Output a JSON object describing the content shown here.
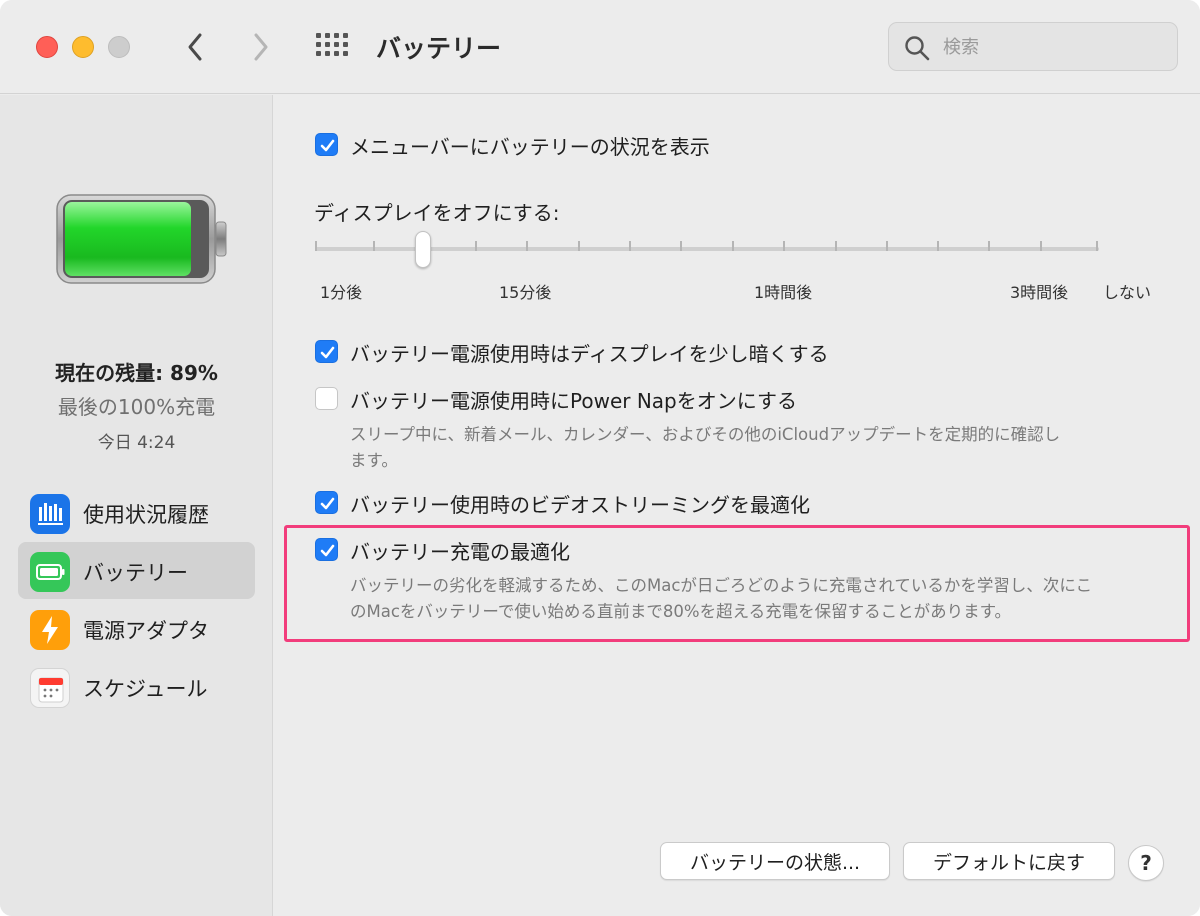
{
  "window": {
    "title": "バッテリー"
  },
  "search": {
    "placeholder": "検索"
  },
  "sidebar": {
    "status_main": "現在の残量: 89%",
    "status_sub": "最後の100%充電",
    "status_time": "今日 4:24",
    "battery_level": 0.89,
    "items": [
      {
        "label": "使用状況履歴",
        "icon": "usage-history-icon",
        "selected": false
      },
      {
        "label": "バッテリー",
        "icon": "battery-icon",
        "selected": true
      },
      {
        "label": "電源アダプタ",
        "icon": "power-adapter-icon",
        "selected": false
      },
      {
        "label": "スケジュール",
        "icon": "calendar-icon",
        "selected": false
      }
    ]
  },
  "settings": {
    "show_menu_status": {
      "label": "メニューバーにバッテリーの状況を表示",
      "checked": true
    },
    "display_off": {
      "label": "ディスプレイをオフにする:",
      "ticks": [
        "1分後",
        "15分後",
        "1時間後",
        "3時間後",
        "しない"
      ],
      "value_label": "15分後"
    },
    "dim_display": {
      "label": "バッテリー電源使用時はディスプレイを少し暗くする",
      "checked": true
    },
    "power_nap": {
      "label": "バッテリー電源使用時にPower Napをオンにする",
      "checked": false,
      "description_1": "スリープ中に、新着メール、カレンダー、およびその他のiCloudアップデートを定期的に確認し",
      "description_2": "ます。"
    },
    "video_streaming": {
      "label": "バッテリー使用時のビデオストリーミングを最適化",
      "checked": true
    },
    "optimized_charging": {
      "label": "バッテリー充電の最適化",
      "checked": true,
      "description_1": "バッテリーの劣化を軽減するため、このMacが日ごろどのように充電されているかを学習し、次にこ",
      "description_2": "のMacをバッテリーで使い始める直前まで80%を超える充電を保留することがあります。"
    }
  },
  "buttons": {
    "battery_health": "バッテリーの状態...",
    "restore_defaults": "デフォルトに戻す",
    "help": "?"
  },
  "colors": {
    "accent": "#1f7cf6",
    "highlight": "#f23d7c",
    "battery_green": "#22d62a"
  }
}
